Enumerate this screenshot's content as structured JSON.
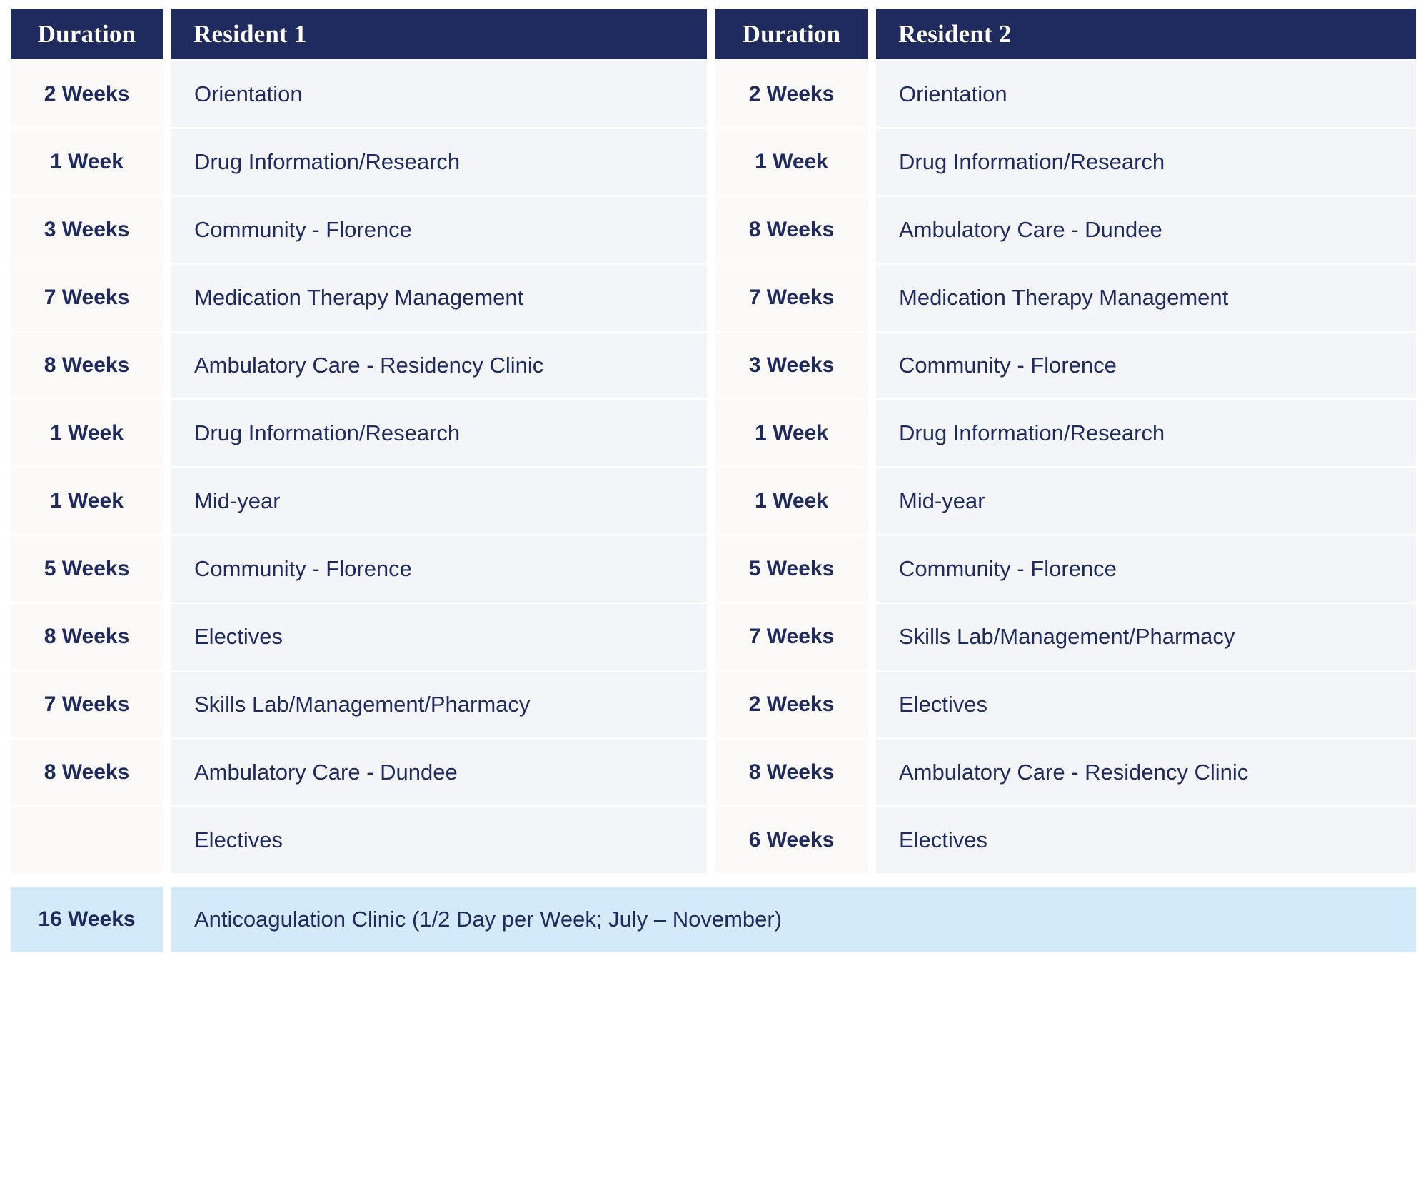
{
  "table": {
    "headers": {
      "duration_left": "Duration",
      "resident_1": "Resident 1",
      "duration_right": "Duration",
      "resident_2": "Resident 2"
    },
    "colors": {
      "header_background": "#1f2a5e",
      "header_text": "#ffffff",
      "body_text": "#1f2a5e",
      "duration_cell_background": "#fbfaf8",
      "name_cell_background": "#f3f5f8",
      "highlight_row_background": "#d3eafa"
    },
    "rows": [
      {
        "duration_1": "2 Weeks",
        "rotation_1": "Orientation",
        "duration_2": "2 Weeks",
        "rotation_2": "Orientation"
      },
      {
        "duration_1": "1 Week",
        "rotation_1": "Drug Information/Research",
        "duration_2": "1 Week",
        "rotation_2": "Drug Information/Research"
      },
      {
        "duration_1": "3 Weeks",
        "rotation_1": "Community - Florence",
        "duration_2": "8 Weeks",
        "rotation_2": "Ambulatory Care - Dundee"
      },
      {
        "duration_1": "7 Weeks",
        "rotation_1": "Medication Therapy Management",
        "duration_2": "7 Weeks",
        "rotation_2": "Medication Therapy Management"
      },
      {
        "duration_1": "8 Weeks",
        "rotation_1": "Ambulatory Care - Residency Clinic",
        "duration_2": "3 Weeks",
        "rotation_2": "Community - Florence"
      },
      {
        "duration_1": "1 Week",
        "rotation_1": "Drug Information/Research",
        "duration_2": "1 Week",
        "rotation_2": "Drug Information/Research"
      },
      {
        "duration_1": "1 Week",
        "rotation_1": "Mid-year",
        "duration_2": "1 Week",
        "rotation_2": "Mid-year"
      },
      {
        "duration_1": "5 Weeks",
        "rotation_1": "Community - Florence",
        "duration_2": "5 Weeks",
        "rotation_2": "Community - Florence"
      },
      {
        "duration_1": "8 Weeks",
        "rotation_1": "Electives",
        "duration_2": "7 Weeks",
        "rotation_2": "Skills Lab/Management/Pharmacy"
      },
      {
        "duration_1": "7 Weeks",
        "rotation_1": "Skills Lab/Management/Pharmacy",
        "duration_2": "2 Weeks",
        "rotation_2": "Electives"
      },
      {
        "duration_1": "8 Weeks",
        "rotation_1": "Ambulatory Care - Dundee",
        "duration_2": "8 Weeks",
        "rotation_2": "Ambulatory Care - Residency Clinic"
      },
      {
        "duration_1": "",
        "rotation_1": "Electives",
        "duration_2": "6 Weeks",
        "rotation_2": "Electives"
      }
    ],
    "footer": {
      "duration": "16 Weeks",
      "rotation": "Anticoagulation Clinic (1/2 Day per Week; July – November)"
    }
  }
}
